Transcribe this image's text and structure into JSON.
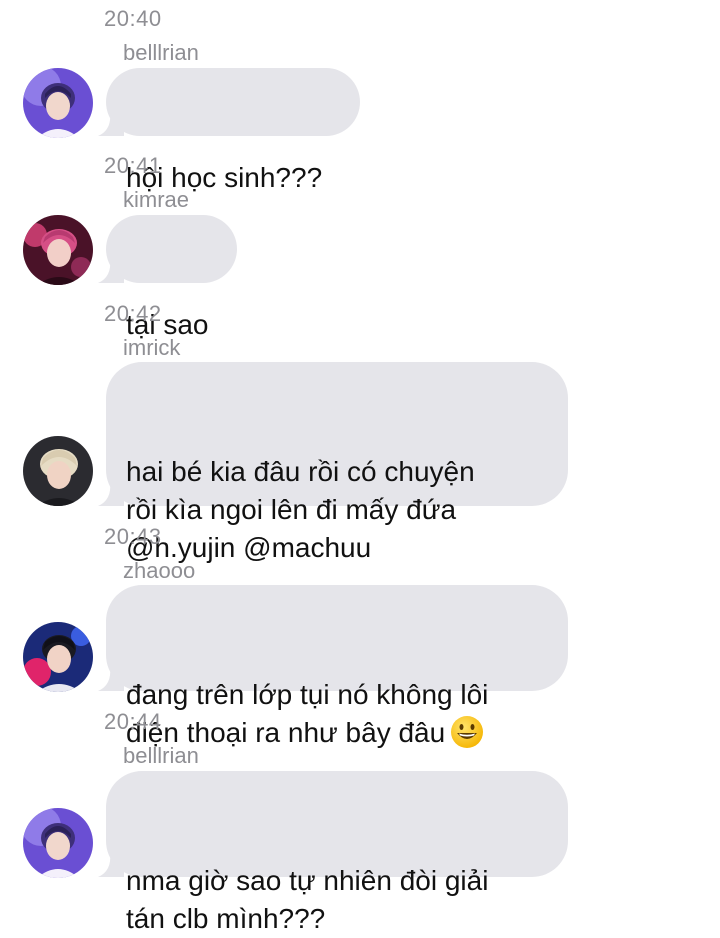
{
  "messages": [
    {
      "time": "20:40",
      "sender": "belllrian",
      "text": "hội học sinh???",
      "avatar_icon": "boy-purple-avatar-icon"
    },
    {
      "time": "20:41",
      "sender": "kimrae",
      "text": "tại sao",
      "avatar_icon": "boy-pink-avatar-icon"
    },
    {
      "time": "20:42",
      "sender": "imrick",
      "text": "hai bé kia đâu rồi có chuyện\nrồi kìa ngoi lên đi mấy đứa\n@h.yujin @machuu",
      "avatar_icon": "boy-blonde-avatar-icon"
    },
    {
      "time": "20:43",
      "sender": "zhaooo",
      "text": "đang trên lớp tụi nó không lôi\nđiện thoại ra như bây đâu",
      "emoji": "grinning-face-emoji",
      "avatar_icon": "boy-stage-avatar-icon"
    },
    {
      "time": "20:44",
      "sender": "belllrian",
      "text": "nma giờ sao tự nhiên đòi giải\ntán clb mình???",
      "avatar_icon": "boy-purple-avatar-icon"
    }
  ],
  "colors": {
    "bubble": "#e5e5ea",
    "meta_text": "#8e8e93",
    "message_text": "#111111"
  }
}
